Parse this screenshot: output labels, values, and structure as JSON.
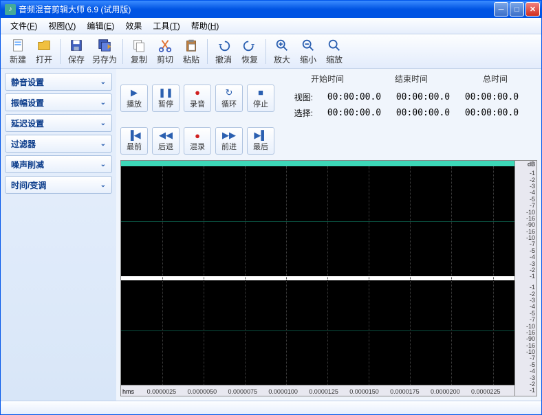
{
  "title": "音频混音剪辑大师 6.9 (试用版)",
  "menu": [
    {
      "label": "文件",
      "key": "F"
    },
    {
      "label": "视图",
      "key": "V"
    },
    {
      "label": "编辑",
      "key": "E"
    },
    {
      "label": "效果",
      "key": ""
    },
    {
      "label": "工具",
      "key": "T"
    },
    {
      "label": "帮助",
      "key": "H"
    }
  ],
  "toolbar": [
    {
      "name": "new",
      "label": "新建",
      "icon": "file"
    },
    {
      "name": "open",
      "label": "打开",
      "icon": "folder"
    },
    {
      "sep": true
    },
    {
      "name": "save",
      "label": "保存",
      "icon": "disk"
    },
    {
      "name": "saveas",
      "label": "另存为",
      "icon": "disk2"
    },
    {
      "sep": true
    },
    {
      "name": "copy",
      "label": "复制",
      "icon": "copy"
    },
    {
      "name": "cut",
      "label": "剪切",
      "icon": "cut"
    },
    {
      "name": "paste",
      "label": "粘贴",
      "icon": "paste"
    },
    {
      "sep": true
    },
    {
      "name": "undo",
      "label": "撤消",
      "icon": "undo"
    },
    {
      "name": "redo",
      "label": "恢复",
      "icon": "redo"
    },
    {
      "sep": true
    },
    {
      "name": "zoomin",
      "label": "放大",
      "icon": "zin"
    },
    {
      "name": "zoomout",
      "label": "缩小",
      "icon": "zout"
    },
    {
      "name": "zoomfit",
      "label": "缩放",
      "icon": "zfit"
    }
  ],
  "sidebar": [
    "静音设置",
    "振幅设置",
    "延迟设置",
    "过滤器",
    "噪声削减",
    "时间/变调"
  ],
  "playback_row1": [
    {
      "name": "play",
      "label": "播放",
      "glyph": "▶",
      "color": "#2a5fb0"
    },
    {
      "name": "pause",
      "label": "暂停",
      "glyph": "❚❚",
      "color": "#2a5fb0"
    },
    {
      "name": "record",
      "label": "录音",
      "glyph": "●",
      "color": "#d02020"
    },
    {
      "name": "loop",
      "label": "循环",
      "glyph": "↻",
      "color": "#2a5fb0"
    },
    {
      "name": "stop",
      "label": "停止",
      "glyph": "■",
      "color": "#2a5fb0"
    }
  ],
  "playback_row2": [
    {
      "name": "first",
      "label": "最前",
      "glyph": "▐◀",
      "color": "#2a5fb0"
    },
    {
      "name": "back",
      "label": "后退",
      "glyph": "◀◀",
      "color": "#2a5fb0"
    },
    {
      "name": "mix",
      "label": "混录",
      "glyph": "●",
      "color": "#d02020"
    },
    {
      "name": "forward",
      "label": "前进",
      "glyph": "▶▶",
      "color": "#2a5fb0"
    },
    {
      "name": "last",
      "label": "最后",
      "glyph": "▶▌",
      "color": "#2a5fb0"
    }
  ],
  "time_headers": [
    "开始时间",
    "结束时间",
    "总时间"
  ],
  "time_rows": [
    {
      "label": "视图:",
      "vals": [
        "00:00:00.0",
        "00:00:00.0",
        "00:00:00.0"
      ]
    },
    {
      "label": "选择:",
      "vals": [
        "00:00:00.0",
        "00:00:00.0",
        "00:00:00.0"
      ]
    }
  ],
  "db_unit": "dB",
  "db_ticks": [
    "-1",
    "-2",
    "-3",
    "-4",
    "-5",
    "-7",
    "-10",
    "-16",
    "-90",
    "-16",
    "-10",
    "-7",
    "-5",
    "-4",
    "-3",
    "-2",
    "-1"
  ],
  "ruler_unit": "hms",
  "ruler_ticks": [
    "0.0000025",
    "0.0000050",
    "0.0000075",
    "0.0000100",
    "0.0000125",
    "0.0000150",
    "0.0000175",
    "0.0000200",
    "0.0000225"
  ]
}
